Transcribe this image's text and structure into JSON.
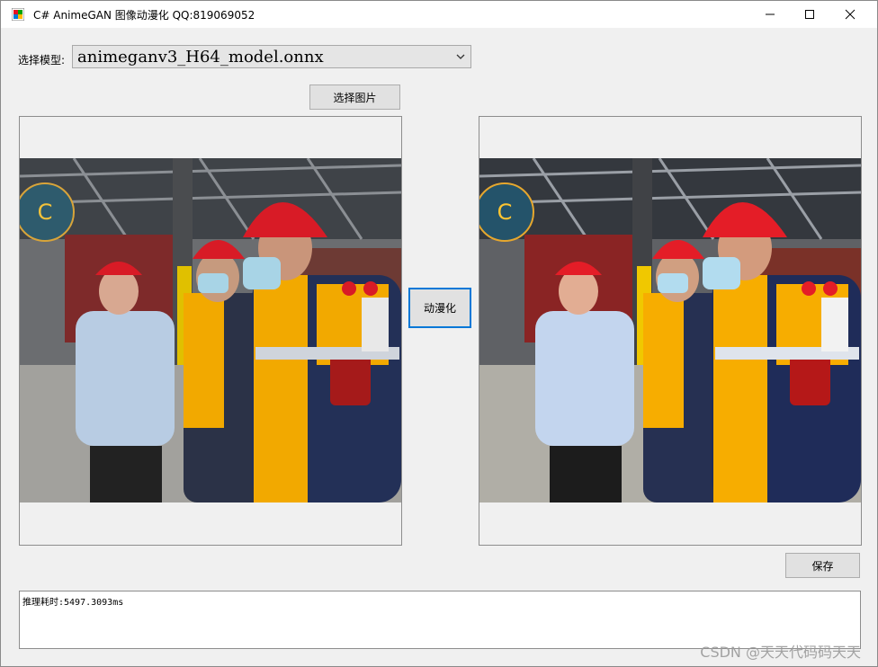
{
  "window": {
    "title": "C# AnimeGAN 图像动漫化 QQ:819069052",
    "controls": [
      "minimize-icon",
      "maximize-icon",
      "close-icon"
    ]
  },
  "form": {
    "model_label": "选择模型:",
    "model_selected": "animeganv3_H64_model.onnx",
    "select_image_button": "选择图片",
    "anime_button": "动漫化",
    "save_button": "保存"
  },
  "log": {
    "text": "推理耗时:5497.3093ms"
  },
  "watermark": "CSDN @天天代码码天天",
  "colors": {
    "form_bg": "#f0f0f0",
    "button_bg": "#e1e1e1",
    "focus_border": "#0078d7",
    "helmet_red": "#d81b26",
    "vest_yellow": "#f2a900"
  }
}
